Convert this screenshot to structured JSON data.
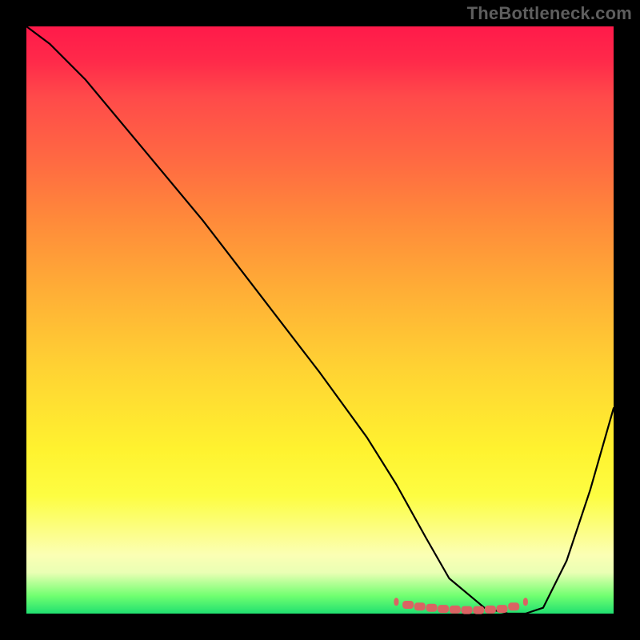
{
  "watermark": "TheBottleneck.com",
  "chart_data": {
    "type": "line",
    "title": "",
    "xlabel": "",
    "ylabel": "",
    "xlim": [
      0,
      100
    ],
    "ylim": [
      0,
      100
    ],
    "series": [
      {
        "name": "main-curve",
        "color": "#000000",
        "x": [
          0,
          4,
          10,
          20,
          30,
          40,
          50,
          58,
          63,
          68,
          72,
          78,
          82,
          85,
          88,
          92,
          96,
          100
        ],
        "y": [
          100,
          97,
          91,
          79,
          67,
          54,
          41,
          30,
          22,
          13,
          6,
          1,
          0,
          0,
          1,
          9,
          21,
          35
        ]
      },
      {
        "name": "marker-band",
        "color": "#da6363",
        "x": [
          63,
          65,
          67,
          69,
          71,
          73,
          75,
          77,
          79,
          81,
          83,
          85
        ],
        "y": [
          2,
          1.5,
          1.2,
          1.0,
          0.8,
          0.7,
          0.6,
          0.6,
          0.7,
          0.8,
          1.2,
          2
        ]
      }
    ],
    "grid": false,
    "legend": false
  }
}
